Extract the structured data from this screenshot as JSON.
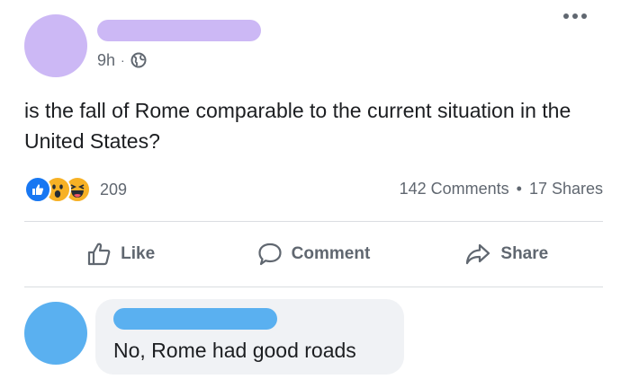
{
  "colors": {
    "avatar_post": "#ccb8f5",
    "name_redaction_post": "#ccb8f5",
    "avatar_comment": "#5ab0f0",
    "name_redaction_comment": "#5ab0f0",
    "like_blue": "#1877f2",
    "emoji_yellow": "#f7b125"
  },
  "post": {
    "time": "9h",
    "separator": "·",
    "privacy_icon": "globe-icon",
    "text": "is the fall of Rome comparable to the current situation in the United States?",
    "more_icon": "more-options-icon"
  },
  "reactions": {
    "icons": [
      "like-reaction-icon",
      "wow-reaction-icon",
      "haha-reaction-icon"
    ],
    "count": "209"
  },
  "stats": {
    "comments": "142 Comments",
    "separator": "•",
    "shares": "17 Shares"
  },
  "actions": {
    "like_label": "Like",
    "comment_label": "Comment",
    "share_label": "Share"
  },
  "comment": {
    "text": "No, Rome had good roads"
  }
}
